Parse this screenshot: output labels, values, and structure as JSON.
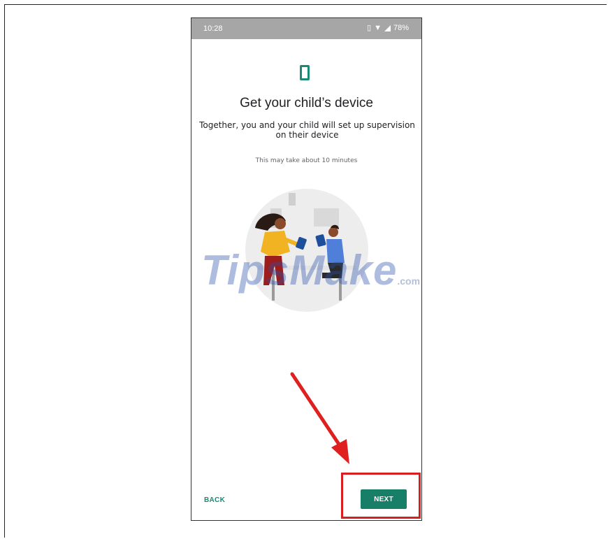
{
  "status_bar": {
    "time": "10:28",
    "battery": "78%",
    "icons": [
      "vibrate-icon",
      "wifi-icon",
      "signal-icon"
    ]
  },
  "screen": {
    "icon": "phone-device-icon",
    "title": "Get your child’s device",
    "subtitle": "Together, you and your child will set up supervision on their device",
    "note": "This may take about 10 minutes",
    "illustration": "parent-and-child-with-tablets"
  },
  "footer": {
    "back_label": "BACK",
    "next_label": "NEXT"
  },
  "overlay": {
    "watermark_text": "TipsMake",
    "watermark_suffix": ".com",
    "annotation": "red-arrow-pointing-to-next",
    "accent_color": "#d81e1e"
  },
  "colors": {
    "primary": "#177e68",
    "status_bar": "#a6a6a6"
  }
}
